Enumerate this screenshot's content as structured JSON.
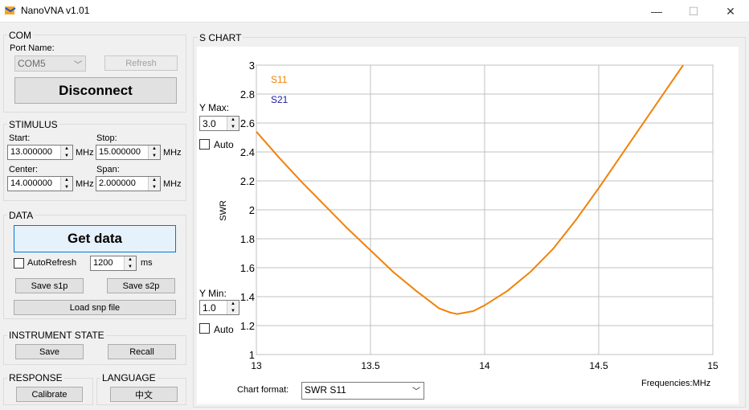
{
  "window": {
    "title": "NanoVNA v1.01",
    "minimize": "—",
    "maximize": "☐",
    "close": "✕"
  },
  "com": {
    "title": "COM",
    "port_label": "Port Name:",
    "port_value": "COM5",
    "refresh": "Refresh",
    "disconnect": "Disconnect"
  },
  "stimulus": {
    "title": "STIMULUS",
    "start_label": "Start:",
    "start_value": "13.000000",
    "stop_label": "Stop:",
    "stop_value": "15.000000",
    "center_label": "Center:",
    "center_value": "14.000000",
    "span_label": "Span:",
    "span_value": "2.000000",
    "unit": "MHz"
  },
  "data": {
    "title": "DATA",
    "get_data": "Get data",
    "autorefresh": "AutoRefresh",
    "interval": "1200",
    "interval_unit": "ms",
    "save_s1p": "Save s1p",
    "save_s2p": "Save s2p",
    "load_snp": "Load snp file"
  },
  "instrument": {
    "title": "INSTRUMENT STATE",
    "save": "Save",
    "recall": "Recall"
  },
  "response": {
    "title": "RESPONSE",
    "calibrate": "Calibrate"
  },
  "language": {
    "title": "LANGUAGE",
    "button": "中文"
  },
  "schart": {
    "title": "S CHART",
    "ymax_label": "Y Max:",
    "ymax_value": "3.0",
    "ymin_label": "Y Min:",
    "ymin_value": "1.0",
    "auto_label": "Auto",
    "format_label": "Chart format:",
    "format_value": "SWR S11",
    "freq_label": "Frequencies:MHz"
  },
  "chart_data": {
    "type": "line",
    "ylabel": "SWR",
    "xlabel": "Frequencies:MHz",
    "xlim": [
      13,
      15
    ],
    "ylim": [
      1,
      3
    ],
    "x_ticks": [
      "13",
      "13.5",
      "14",
      "14.5",
      "15"
    ],
    "y_ticks": [
      "1",
      "1.2",
      "1.4",
      "1.6",
      "1.8",
      "2",
      "2.2",
      "2.4",
      "2.6",
      "2.8",
      "3"
    ],
    "grid": true,
    "legend": "top-left",
    "series": [
      {
        "name": "S11",
        "color": "#f0820a",
        "x": [
          13.0,
          13.1,
          13.2,
          13.3,
          13.4,
          13.5,
          13.6,
          13.7,
          13.75,
          13.8,
          13.85,
          13.88,
          13.95,
          14.0,
          14.1,
          14.2,
          14.3,
          14.4,
          14.5,
          14.6,
          14.7,
          14.8,
          14.87
        ],
        "y": [
          2.54,
          2.36,
          2.19,
          2.03,
          1.87,
          1.72,
          1.57,
          1.44,
          1.38,
          1.32,
          1.29,
          1.28,
          1.3,
          1.34,
          1.44,
          1.57,
          1.73,
          1.93,
          2.15,
          2.38,
          2.61,
          2.84,
          3.0
        ]
      },
      {
        "name": "S21",
        "color": "#1a1aa6",
        "x": [],
        "y": []
      }
    ]
  }
}
